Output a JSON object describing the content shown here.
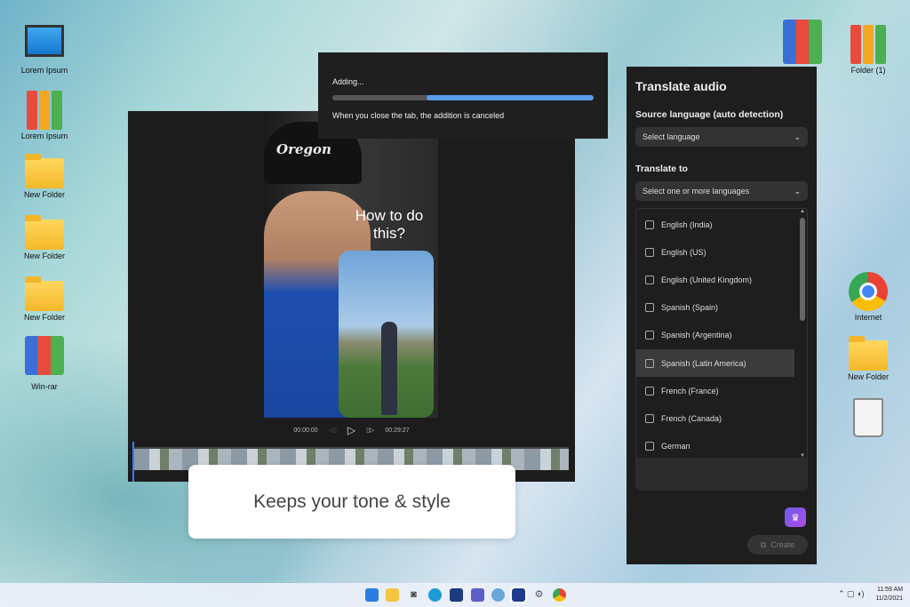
{
  "desktop": {
    "icons": [
      {
        "label": "Lorem Ipsum",
        "type": "computer"
      },
      {
        "label": "Lorem Ipsum",
        "type": "binders"
      },
      {
        "label": "New Folder",
        "type": "folder"
      },
      {
        "label": "New Folder",
        "type": "folder"
      },
      {
        "label": "New Folder",
        "type": "folder"
      },
      {
        "label": "Win-rar",
        "type": "winrar"
      }
    ],
    "right_icons": [
      {
        "label": "Folder (1)",
        "type": "binders"
      },
      {
        "label": "Internet",
        "type": "chrome"
      },
      {
        "label": "New Folder",
        "type": "folder"
      },
      {
        "label": "",
        "type": "recycle-bin"
      }
    ]
  },
  "video": {
    "caption_cap": "Oregon",
    "overlay_text": "How to do this?",
    "time_current": "00:00:00",
    "time_total": "00:29:27"
  },
  "caption_card": "Keeps your tone & style",
  "adding_dialog": {
    "title": "Adding...",
    "progress": 0.64,
    "message": "When you close the tab, the addition is canceled"
  },
  "panel": {
    "title": "Translate audio",
    "source_label": "Source language (auto detection)",
    "source_placeholder": "Select language",
    "target_label": "Translate to",
    "target_placeholder": "Select one or more languages",
    "languages": [
      "English (India)",
      "English (US)",
      "English (United Kingdom)",
      "Spanish (Spain)",
      "Spanish (Argentina)",
      "Spanish (Latin America)",
      "French (France)",
      "French (Canada)",
      "German"
    ],
    "highlighted": "Spanish (Latin America)",
    "create_label": "Create"
  },
  "taskbar": {
    "time": "11:59 AM",
    "date": "11/2/2021"
  },
  "colors": {
    "accent": "#5a9be8",
    "panel": "#1e1e1e"
  }
}
